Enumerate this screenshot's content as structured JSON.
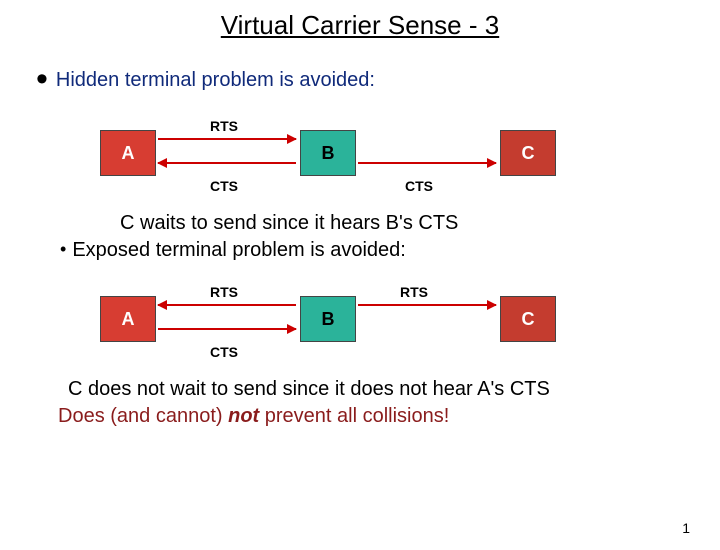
{
  "title": "Virtual Carrier Sense - 3",
  "bullet1": "Hidden terminal problem is avoided:",
  "diagram1": {
    "A": "A",
    "B": "B",
    "C": "C",
    "rts": "RTS",
    "cts_left": "CTS",
    "cts_right": "CTS"
  },
  "caption1": "C waits to send since it hears B's CTS",
  "bullet2": "Exposed terminal problem is avoided:",
  "diagram2": {
    "A": "A",
    "B": "B",
    "C": "C",
    "rts_left": "RTS",
    "rts_right": "RTS",
    "cts": "CTS"
  },
  "caption2": "C does not wait to send since it does not hear A's CTS",
  "conclusion_pre": "Does (and cannot) ",
  "conclusion_em": "not",
  "conclusion_post": " prevent all collisions!",
  "pagenum": "1"
}
